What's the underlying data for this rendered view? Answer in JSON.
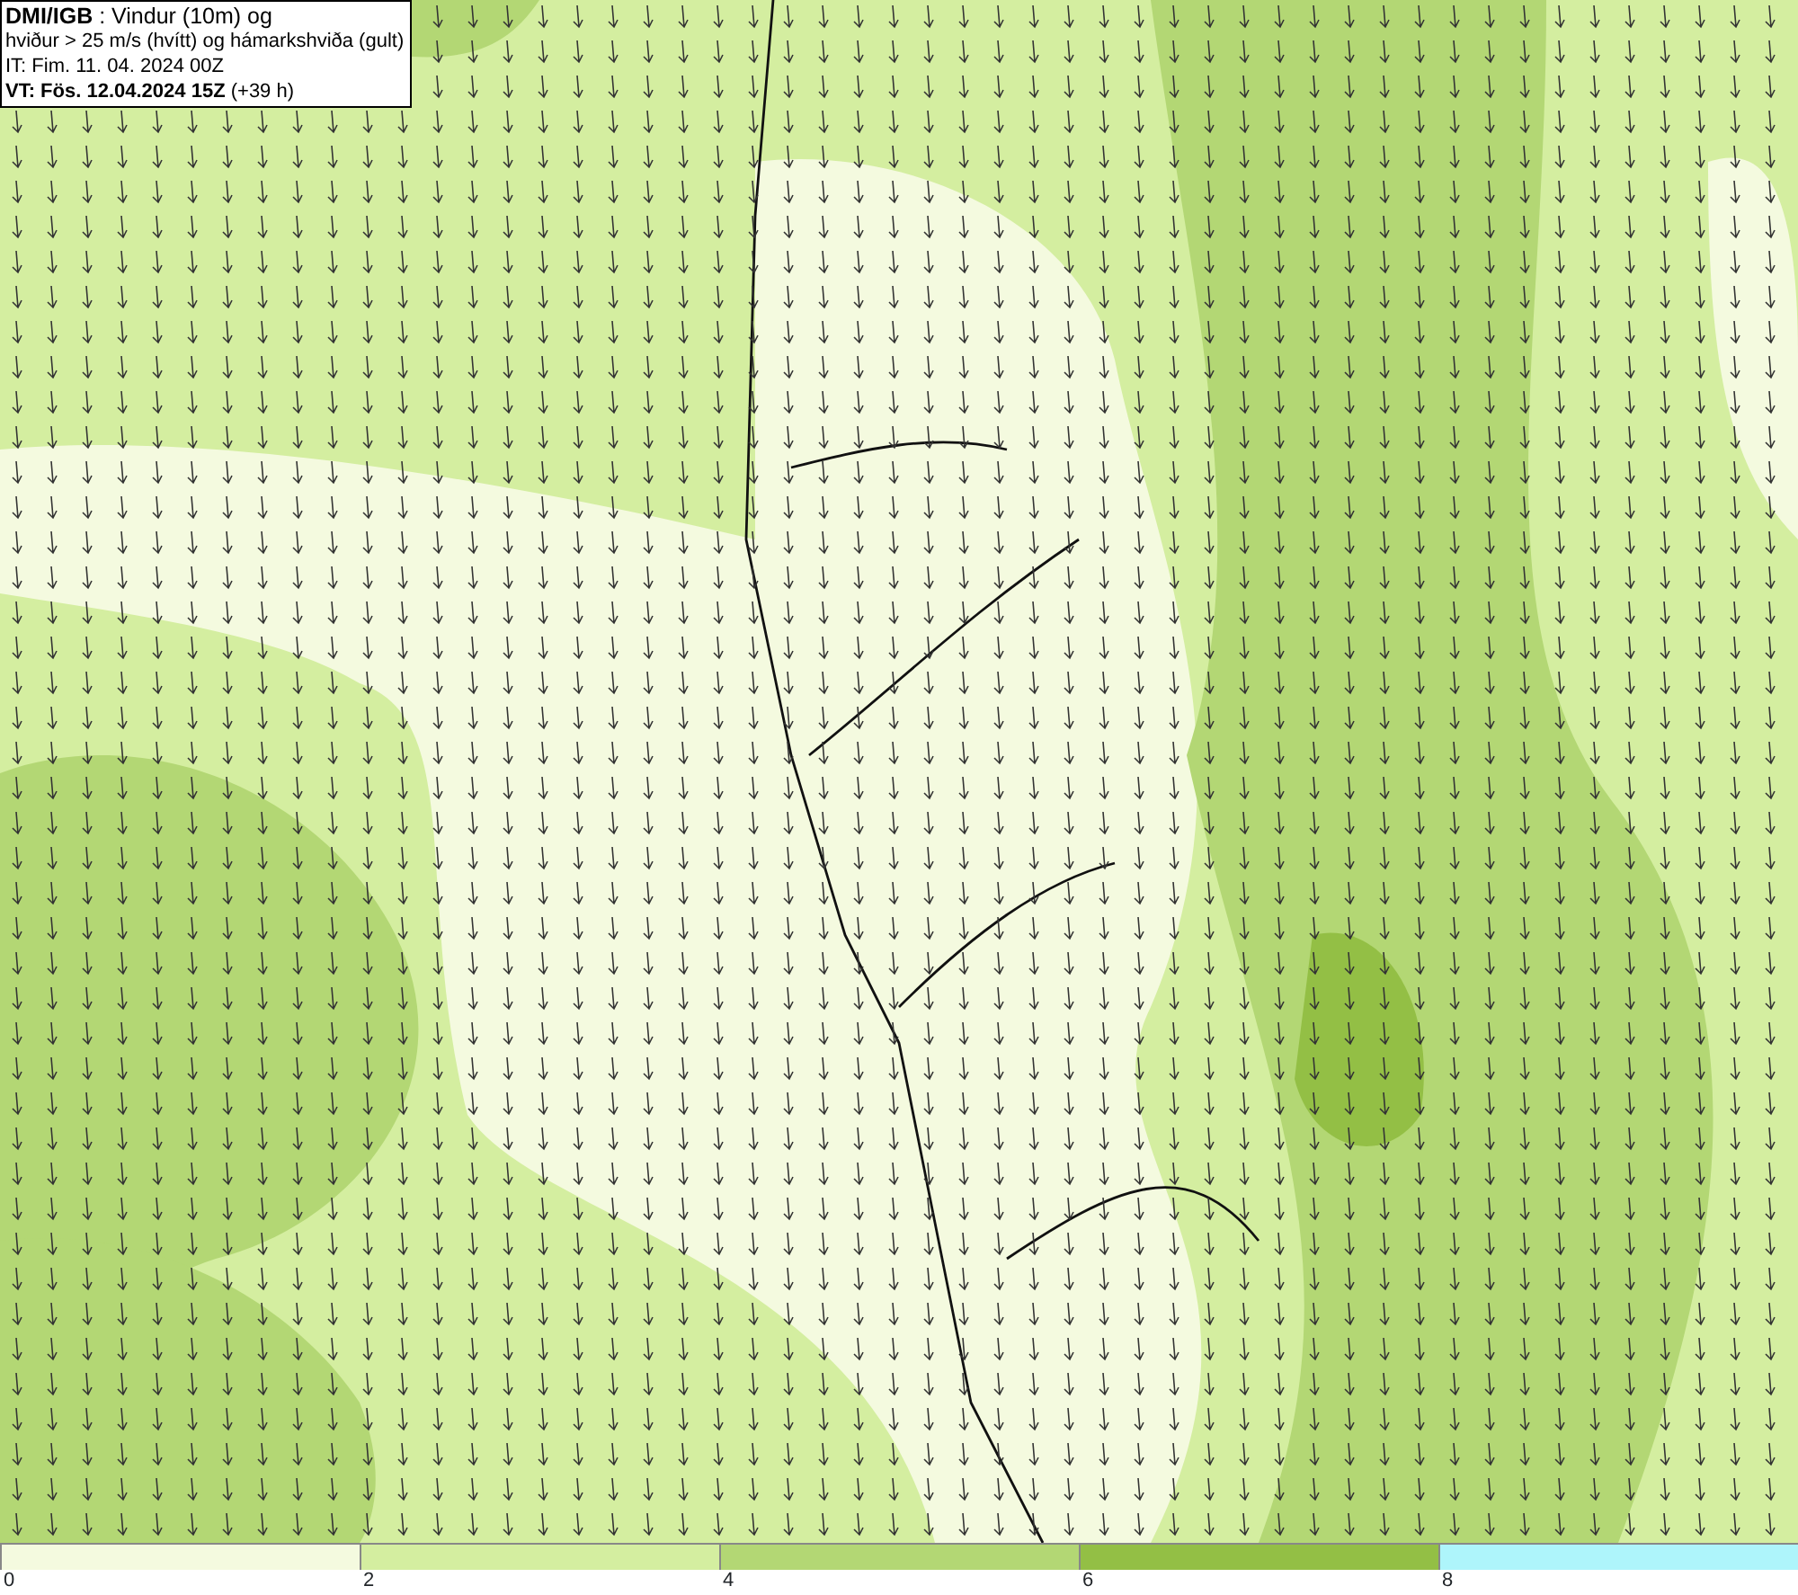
{
  "header": {
    "lines": [
      "**DMI/IGB** : Vindur (10m) og",
      "hviður > 25 m/s (hvítt) og hámarkshviða (gult)",
      "IT: Fim. 11. 04. 2024 00Z",
      "**VT: Fös. 12.04.2024 15Z** (+39 h)"
    ]
  },
  "legend": {
    "bins": [
      {
        "color": "#f4fadf"
      },
      {
        "color": "#d4eea0"
      },
      {
        "color": "#b3d774"
      },
      {
        "color": "#93bf45"
      },
      {
        "color": "#aef5fb"
      }
    ],
    "labels": [
      "0",
      "2",
      "4",
      "6",
      "8"
    ]
  }
}
